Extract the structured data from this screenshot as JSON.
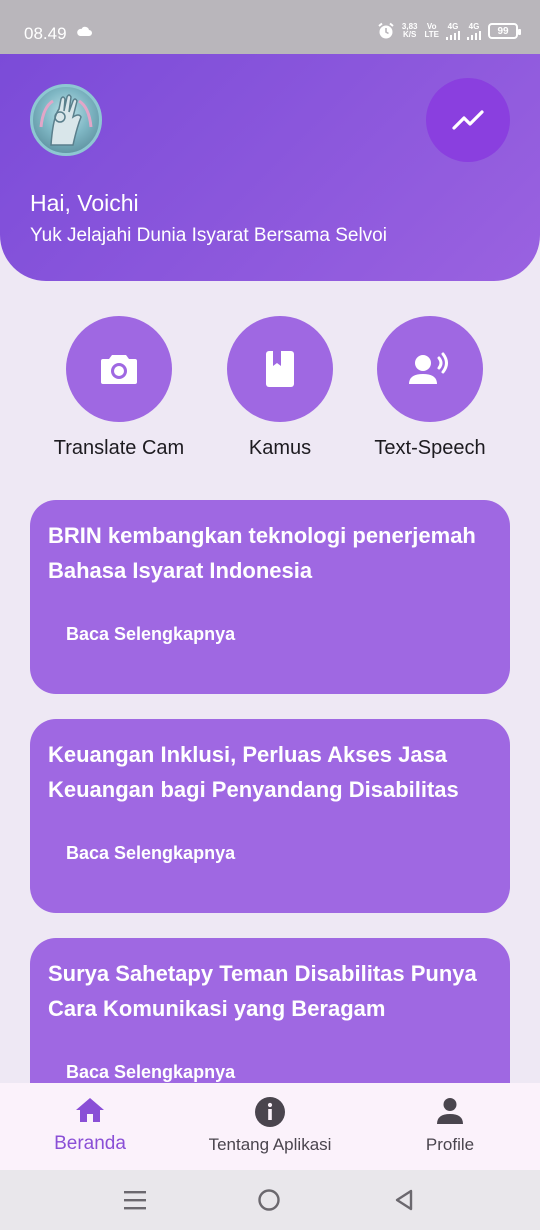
{
  "status_bar": {
    "time": "08.49",
    "network_speed_value": "3,83",
    "network_speed_unit": "K/S",
    "volte_top": "Vo",
    "volte_bottom": "LTE",
    "sim1": "4G",
    "sim2": "4G",
    "battery": "99"
  },
  "header": {
    "greeting": "Hai, Voichi",
    "subtitle": "Yuk Jelajahi Dunia Isyarat Bersama Selvoi"
  },
  "features": [
    {
      "label": "Translate Cam",
      "icon": "camera-icon"
    },
    {
      "label": "Kamus",
      "icon": "book-icon"
    },
    {
      "label": "Text-Speech",
      "icon": "speaker-person-icon"
    }
  ],
  "news": [
    {
      "title": "BRIN kembangkan teknologi penerjemah Bahasa Isyarat Indonesia",
      "link": "Baca Selengkapnya"
    },
    {
      "title": "Keuangan Inklusi, Perluas Akses Jasa Keuangan bagi Penyandang Disabilitas",
      "link": "Baca Selengkapnya"
    },
    {
      "title": "Surya Sahetapy Teman Disabilitas Punya Cara Komunikasi yang Beragam",
      "link": "Baca Selengkapnya"
    }
  ],
  "bottom_nav": [
    {
      "label": "Beranda",
      "icon": "home-icon",
      "active": true
    },
    {
      "label": "Tentang Aplikasi",
      "icon": "info-icon",
      "active": false
    },
    {
      "label": "Profile",
      "icon": "person-icon",
      "active": false
    }
  ],
  "colors": {
    "primary": "#9f68e2",
    "header_start": "#7b4bd8",
    "header_end": "#9a62e0",
    "accent_button": "#8a3fdf",
    "active_nav": "#8a4fd6",
    "background": "#eee8f4"
  }
}
